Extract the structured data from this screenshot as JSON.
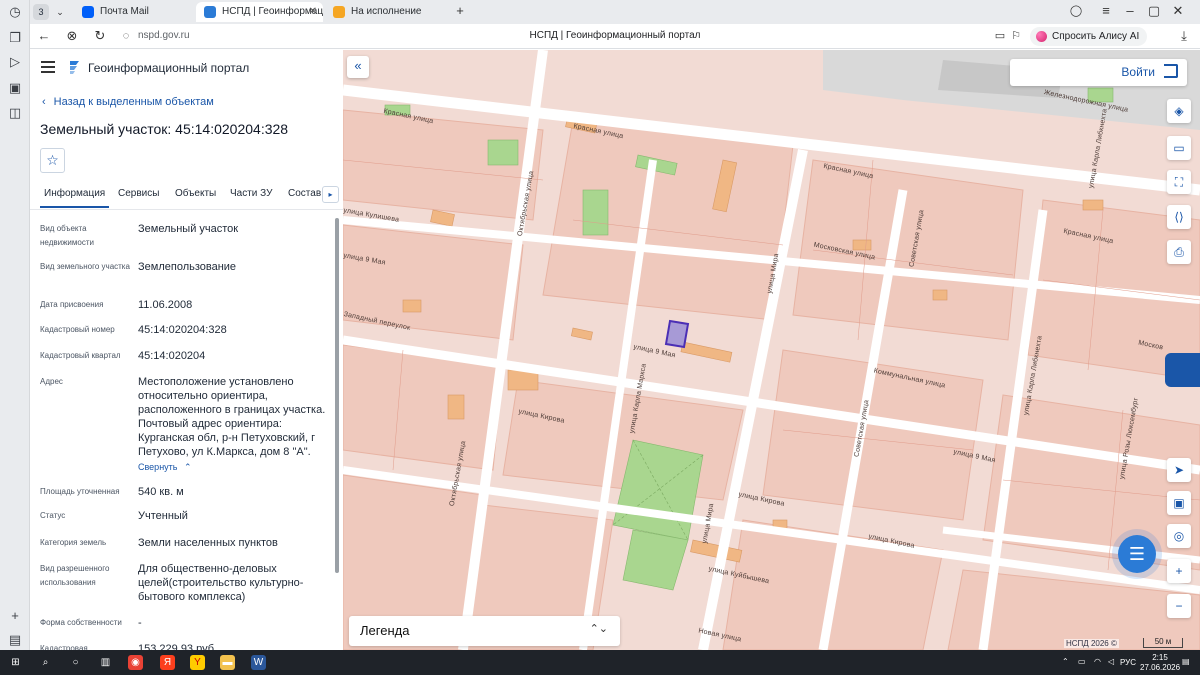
{
  "browser": {
    "tab_count": "3",
    "tabs": [
      {
        "title": "Почта Mail",
        "color": "#005ff9"
      },
      {
        "title": "НСПД | Геоинформацио",
        "color": "#2b7bd6"
      },
      {
        "title": "На исполнение",
        "color": "#f5a623"
      }
    ],
    "url": "nspd.gov.ru",
    "page_title": "НСПД | Геоинформационный портал",
    "alice_label": "Спросить Алису AI"
  },
  "portal": {
    "name": "Геоинформационный портал",
    "back_label": "Назад к выделенным объектам",
    "object_title": "Земельный участок: 45:14:020204:328",
    "tabs": [
      "Информация",
      "Сервисы",
      "Объекты",
      "Части ЗУ",
      "Состав"
    ],
    "fields": [
      {
        "key": "Вид объекта недвижимости",
        "value": "Земельный участок"
      },
      {
        "key": "Вид земельного участка",
        "value": "Землепользование"
      },
      {
        "key": "Дата присвоения",
        "value": "11.06.2008"
      },
      {
        "key": "Кадастровый номер",
        "value": "45:14:020204:328"
      },
      {
        "key": "Кадастровый квартал",
        "value": "45:14:020204"
      },
      {
        "key": "Адрес",
        "value": "Местоположение установлено относительно ориентира, расположенного в границах участка. Почтовый адрес ориентира: Курганская обл, р-н Петуховский, г Петухово, ул К.Маркса, дом 8 \"А\"."
      },
      {
        "key": "Площадь уточненная",
        "value": "540 кв. м"
      },
      {
        "key": "Статус",
        "value": "Учтенный"
      },
      {
        "key": "Категория земель",
        "value": "Земли населенных пунктов"
      },
      {
        "key": "Вид разрешенного использования",
        "value": "Для общественно-деловых целей(строительство культурно-бытового комплекса)"
      },
      {
        "key": "Форма собственности",
        "value": "-"
      },
      {
        "key": "Кадастровая",
        "value": "153 229,93 руб."
      }
    ],
    "collapse_label": "Свернуть"
  },
  "map": {
    "login_label": "Войти",
    "legend_label": "Легенда",
    "copyright": "НСПД 2026 ©",
    "scale_label": "50 м",
    "streets": [
      "Красная улица",
      "улица Кулишева",
      "Октябрьская улица",
      "улица 9 Мая",
      "Западный переулок",
      "улица Карла Маркса",
      "улица Кирова",
      "улица Мира",
      "Московская улица",
      "Советская улица",
      "Коммунальная улица",
      "улица Карла Либкнехта",
      "Железнодорожная улица",
      "улица Куйбышева",
      "Новая улица",
      "улица Розы Люксембург",
      "Москов"
    ]
  },
  "taskbar": {
    "lang": "РУС",
    "time": "2:15",
    "date": "27.06.2026"
  }
}
